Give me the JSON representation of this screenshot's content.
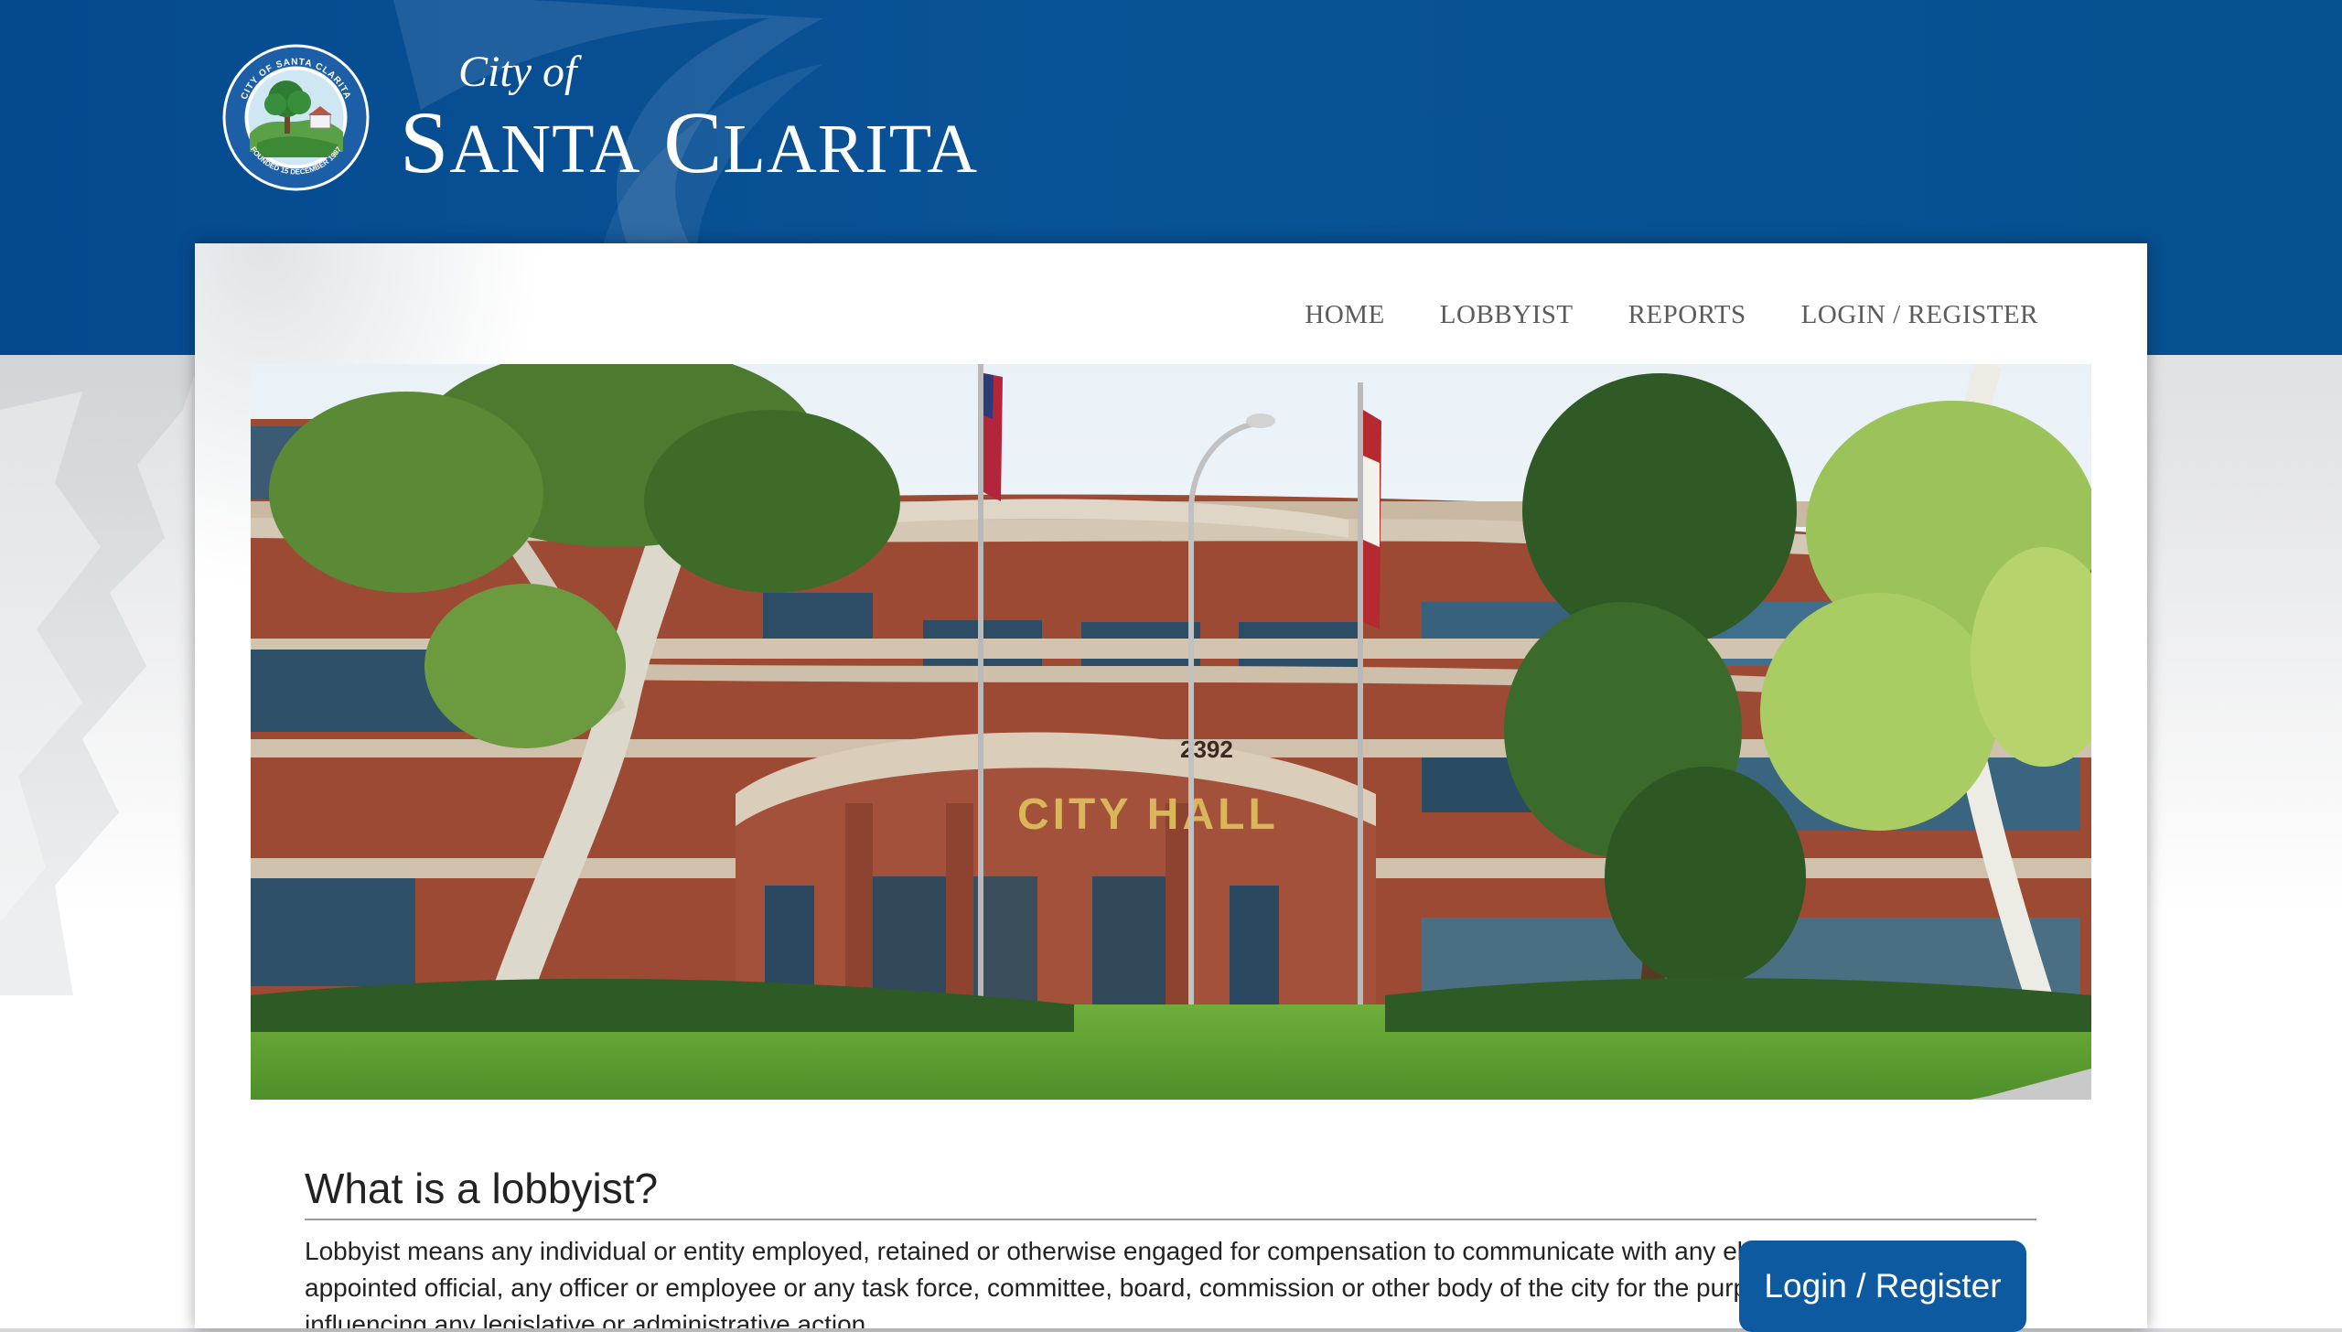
{
  "branding": {
    "city_of": "City of",
    "city_name_s": "S",
    "city_name_anta": "ANTA",
    "city_name_c": "C",
    "city_name_larita": "LARITA",
    "seal_text_top": "CITY OF SANTA CLARITA",
    "seal_text_bottom": "FOUNDED 15 DECEMBER 1987"
  },
  "nav": {
    "items": [
      {
        "label": "HOME"
      },
      {
        "label": "LOBBYIST"
      },
      {
        "label": "REPORTS"
      },
      {
        "label": "LOGIN / REGISTER"
      }
    ]
  },
  "hero": {
    "address_number": "2392",
    "sign": "CITY HALL"
  },
  "content": {
    "title": "What is a lobbyist?",
    "description": "Lobbyist means any individual or entity employed, retained or otherwise engaged for compensation to communicate with any elective or appointed official, any officer or employee or any task force, committee, board, commission or other body of the city for the purpose of influencing any legislative or administrative action.",
    "cta_label": "Login / Register"
  },
  "colors": {
    "header_blue": "#0a5297",
    "button_blue": "#0e5aa0",
    "nav_text": "#5b5b5b"
  }
}
